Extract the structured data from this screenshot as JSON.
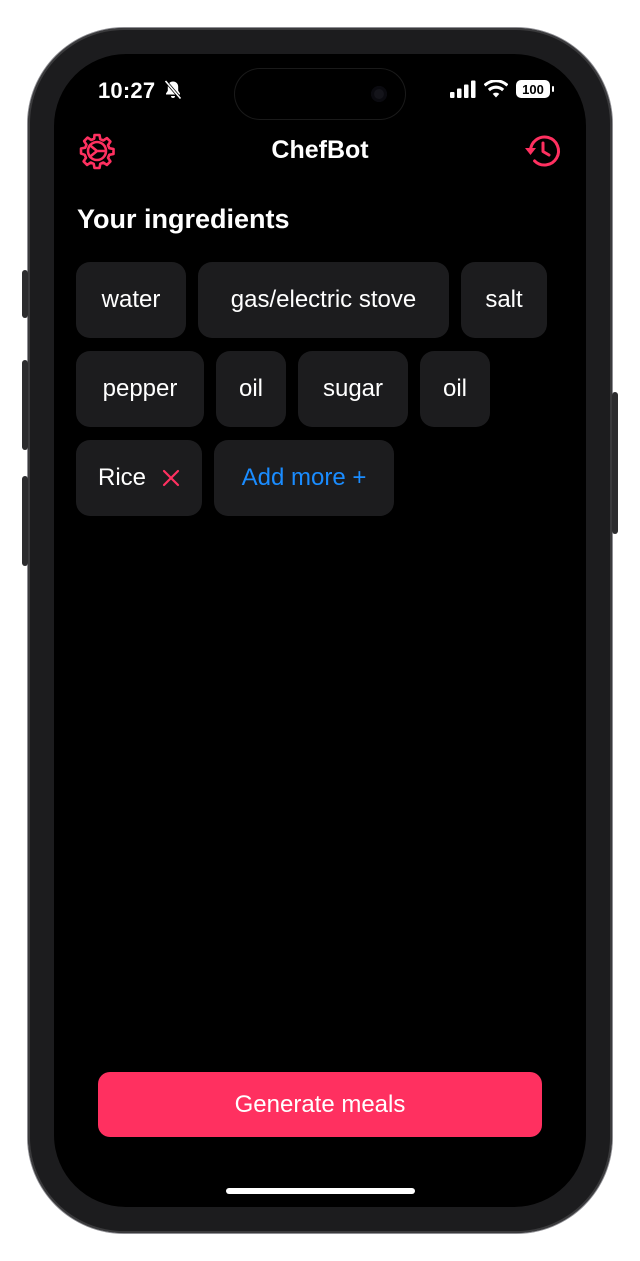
{
  "status_bar": {
    "time": "10:27",
    "battery_level": "100"
  },
  "nav": {
    "title": "ChefBot",
    "left_icon": "settings-gear-icon",
    "right_icon": "history-icon"
  },
  "ingredients": {
    "title": "Your ingredients",
    "items": [
      {
        "label": "water",
        "removable": false
      },
      {
        "label": "gas/electric stove",
        "removable": false
      },
      {
        "label": "salt",
        "removable": false
      },
      {
        "label": "pepper",
        "removable": false
      },
      {
        "label": "oil",
        "removable": false
      },
      {
        "label": "sugar",
        "removable": false
      },
      {
        "label": "oil",
        "removable": false
      },
      {
        "label": "Rice",
        "removable": true
      }
    ],
    "add_more_label": "Add more +"
  },
  "actions": {
    "generate_label": "Generate meals"
  },
  "colors": {
    "accent": "#ff3060",
    "link": "#1a8cff",
    "chip_bg": "#1c1c1e",
    "background": "#000000"
  }
}
